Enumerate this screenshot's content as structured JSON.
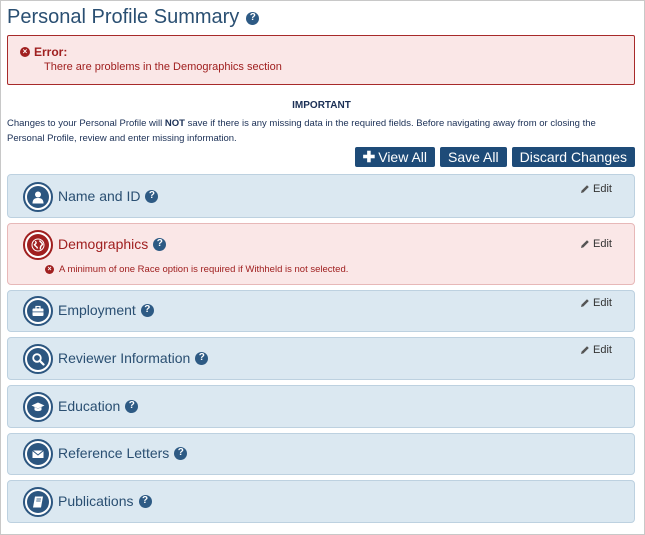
{
  "page": {
    "title": "Personal Profile Summary",
    "help_glyph": "?"
  },
  "error": {
    "label": "Error:",
    "message": "There are problems in the Demographics section"
  },
  "notice": {
    "heading": "IMPORTANT",
    "text_before": "Changes to your Personal Profile will ",
    "text_bold": "NOT",
    "text_after": " save if there is any missing data in the required fields. Before navigating away from or closing the Personal Profile, review and enter missing information."
  },
  "buttons": {
    "view_all": "View All",
    "save_all": "Save All",
    "discard": "Discard Changes"
  },
  "edit_label": "Edit",
  "sections": [
    {
      "label": "Name and ID",
      "icon": "person-icon",
      "editable": true
    },
    {
      "label": "Demographics",
      "icon": "globe-icon",
      "editable": true,
      "status": "error",
      "error": "A minimum of one Race option is required if Withheld is not selected."
    },
    {
      "label": "Employment",
      "icon": "briefcase-icon",
      "editable": true
    },
    {
      "label": "Reviewer Information",
      "icon": "magnifier-icon",
      "editable": true
    },
    {
      "label": "Education",
      "icon": "graduation-cap-icon",
      "editable": false
    },
    {
      "label": "Reference Letters",
      "icon": "envelope-icon",
      "editable": false
    },
    {
      "label": "Publications",
      "icon": "book-icon",
      "editable": false
    }
  ],
  "colors": {
    "title": "#2a4f72",
    "button": "#1e4b78",
    "section_bg": "#dbe8f1",
    "error": "#a02020",
    "error_bg": "#fae7e7"
  }
}
